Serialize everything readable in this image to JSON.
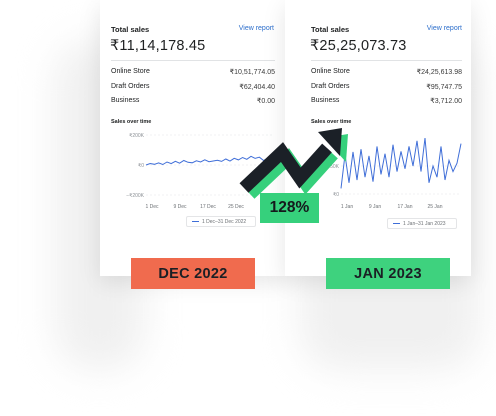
{
  "left_card": {
    "title": "Total sales",
    "link": "View report",
    "total": "₹11,14,178.45",
    "rows": [
      {
        "label": "Online Store",
        "value": "₹10,51,774.05"
      },
      {
        "label": "Draft Orders",
        "value": "₹62,404.40"
      },
      {
        "label": "Business",
        "value": "₹0.00"
      }
    ],
    "chart_title": "Sales over time",
    "legend": "1 Dec–31 Dec 2022"
  },
  "right_card": {
    "title": "Total sales",
    "link": "View report",
    "total": "₹25,25,073.73",
    "rows": [
      {
        "label": "Online Store",
        "value": "₹24,25,613.98"
      },
      {
        "label": "Draft Orders",
        "value": "₹95,747.75"
      },
      {
        "label": "Business",
        "value": "₹3,712.00"
      }
    ],
    "chart_title": "Sales over time",
    "legend": "1 Jan–31 Jan 2023"
  },
  "badges": {
    "left": "DEC 2022",
    "right": "JAN 2023",
    "growth": "128%"
  },
  "colors": {
    "dec_badge": "#f06b4e",
    "jan_badge": "#3ed27e",
    "series_line": "#3f6ed8",
    "arrow_dark": "#1b2027",
    "arrow_green": "#36d07c"
  },
  "icons": {
    "growth_arrow": "trend-up-arrow-icon"
  },
  "chart_data": [
    {
      "type": "line",
      "x_ticks": [
        "1 Dec",
        "9 Dec",
        "17 Dec",
        "25 Dec"
      ],
      "y_ticks": [
        "₹200K",
        "₹0",
        "−₹200K"
      ],
      "ylim": [
        -200000,
        200000
      ],
      "series": [
        {
          "values": [
            0,
            10000,
            5000,
            14000,
            3000,
            20000,
            9000,
            25000,
            12000,
            30000,
            18000,
            15000,
            28000,
            20000,
            35000,
            22000,
            27000,
            31000,
            24000,
            40000,
            26000,
            45000,
            34000,
            50000,
            38000,
            58000,
            44000,
            52000,
            30000,
            46000,
            35000
          ]
        }
      ]
    },
    {
      "type": "line",
      "x_ticks": [
        "1 Jan",
        "9 Jan",
        "17 Jan",
        "25 Jan"
      ],
      "y_ticks": [
        "₹50K",
        "₹0"
      ],
      "ylim": [
        0,
        100000
      ],
      "series": [
        {
          "values": [
            10000,
            70000,
            20000,
            75000,
            25000,
            80000,
            30000,
            68000,
            22000,
            85000,
            35000,
            72000,
            30000,
            88000,
            40000,
            76000,
            45000,
            85000,
            50000,
            95000,
            40000,
            100000,
            20000,
            50000,
            30000,
            85000,
            25000,
            60000,
            40000,
            55000,
            90000
          ]
        }
      ]
    }
  ]
}
